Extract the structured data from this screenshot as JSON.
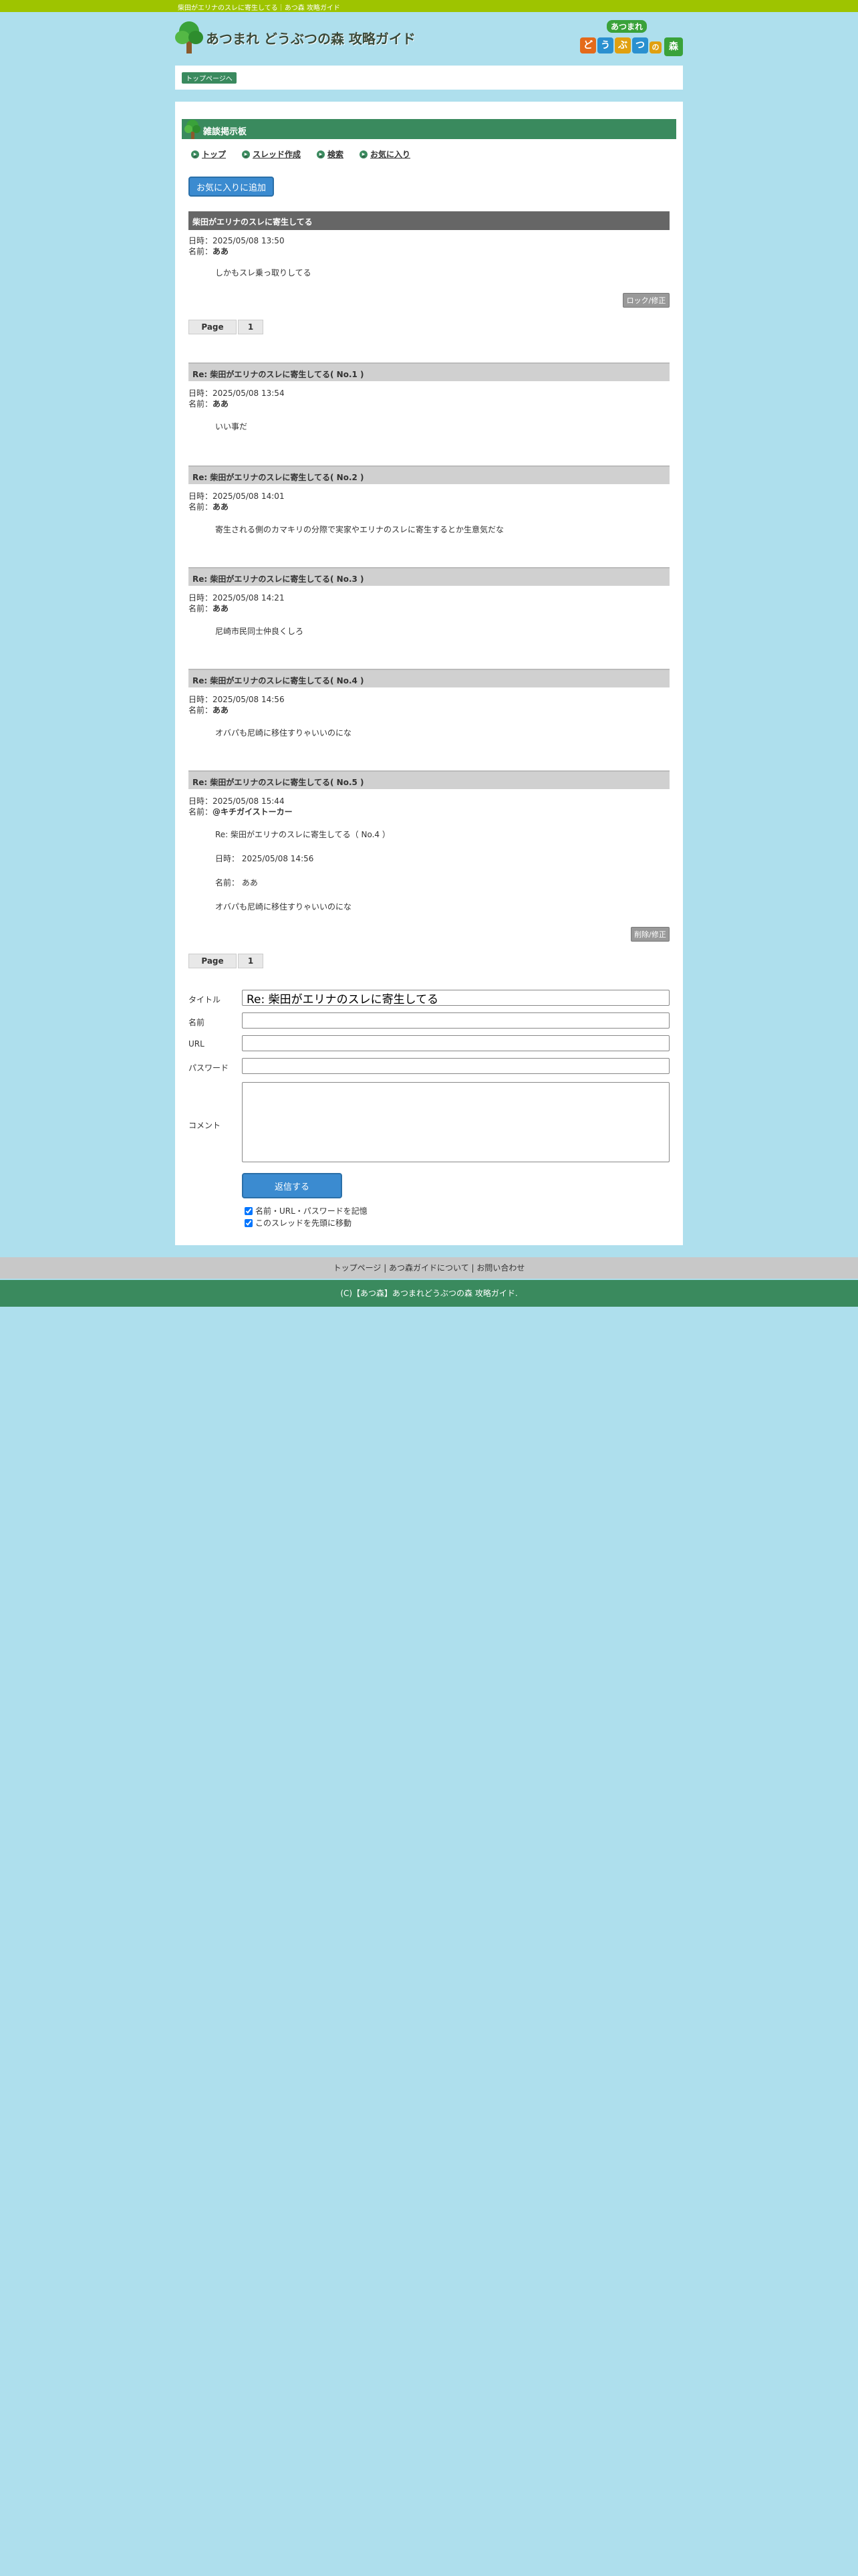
{
  "topbar": {
    "text": "柴田がエリナのスレに寄生してる｜あつ森 攻略ガイド"
  },
  "header": {
    "site_title": "あつまれ どうぶつの森 攻略ガイド",
    "right_logo_top": "あつまれ",
    "right_logo_chars": [
      "ど",
      "う",
      "ぶ",
      "つ",
      "の",
      "森"
    ]
  },
  "breadcrumb": {
    "label": "トップページへ"
  },
  "board": {
    "title": "雑談掲示板",
    "nav": [
      "トップ",
      "スレッド作成",
      "検索",
      "お気に入り"
    ],
    "fav_button": "お気に入りに追加",
    "lock_button": "ロック/修正",
    "delete_button": "削除/修正",
    "pager": {
      "label": "Page",
      "page": "1"
    }
  },
  "thread": {
    "title": "柴田がエリナのスレに寄生してる",
    "date_label": "日時：",
    "name_label": "名前：",
    "date": "2025/05/08 13:50",
    "name": "ああ",
    "body": "しかもスレ乗っ取りしてる"
  },
  "replies": [
    {
      "title": "Re: 柴田がエリナのスレに寄生してる( No.1 )",
      "date": "2025/05/08 13:54",
      "name": "ああ",
      "body": "いい事だ"
    },
    {
      "title": "Re: 柴田がエリナのスレに寄生してる( No.2 )",
      "date": "2025/05/08 14:01",
      "name": "ああ",
      "body": "寄生される側のカマキリの分際で実家やエリナのスレに寄生するとか生意気だな"
    },
    {
      "title": "Re: 柴田がエリナのスレに寄生してる( No.3 )",
      "date": "2025/05/08 14:21",
      "name": "ああ",
      "body": "尼崎市民同士仲良くしろ"
    },
    {
      "title": "Re: 柴田がエリナのスレに寄生してる( No.4 )",
      "date": "2025/05/08 14:56",
      "name": "ああ",
      "body": "オバパも尼崎に移住すりゃいいのにな"
    },
    {
      "title": "Re: 柴田がエリナのスレに寄生してる( No.5 )",
      "date": "2025/05/08 15:44",
      "name": "@キチガイストーカー",
      "quote_title": "Re: 柴田がエリナのスレに寄生してる（ No.4 ）",
      "quote_date": "日時： 2025/05/08 14:56",
      "quote_name": "名前： ああ",
      "quote_body": "オバパも尼崎に移住すりゃいいのにな"
    }
  ],
  "form": {
    "title_label": "タイトル",
    "title_value": "Re: 柴田がエリナのスレに寄生してる",
    "name_label": "名前",
    "url_label": "URL",
    "password_label": "パスワード",
    "comment_label": "コメント",
    "submit": "返信する",
    "remember": "名前・URL・パスワードを記憶",
    "move_top": "このスレッドを先頭に移動"
  },
  "footer": {
    "links": [
      "トップページ",
      "あつ森ガイドについて",
      "お問い合わせ"
    ],
    "copyright": "(C)【あつ森】あつまれどうぶつの森 攻略ガイド."
  },
  "colors": {
    "page_bg": "#aedfed",
    "topbar": "#9ec400",
    "accent_green": "#3a8a5e",
    "button_blue": "#3b8bd0"
  }
}
